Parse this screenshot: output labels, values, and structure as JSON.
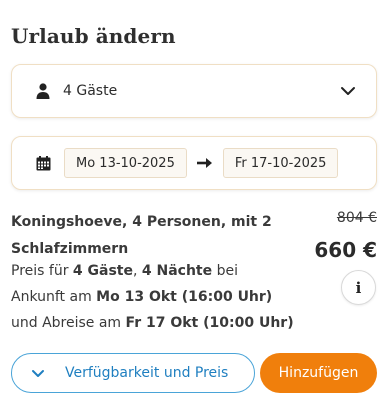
{
  "header": {
    "title": "Urlaub ändern"
  },
  "guests": {
    "label": "4 Gäste",
    "icon": "person-icon",
    "dropdown_icon": "chevron-down-icon"
  },
  "dates": {
    "icon": "calendar-icon",
    "start": "Mo 13-10-2025",
    "arrow_icon": "arrow-right-icon",
    "end": "Fr 17-10-2025"
  },
  "listing": {
    "name": "Koningshoeve, 4 Personen, mit 2 Schlafzimmern",
    "price_prefix": "Preis für ",
    "guests": "4 Gäste",
    "separator": ", ",
    "nights": "4 Nächte",
    "price_suffix": " bei",
    "arrival_prefix": "Ankunft am ",
    "arrival": "Mo 13 Okt (16:00 Uhr)",
    "departure_prefix": "und Abreise am ",
    "departure": "Fr 17 Okt (10:00 Uhr)"
  },
  "price": {
    "old": "804 €",
    "new": "660 €",
    "info_label": "i"
  },
  "actions": {
    "availability_label": "Verfügbarkeit und Preis",
    "add_label": "Hinzufügen"
  },
  "colors": {
    "accent": "#f07f0c",
    "link": "#1f7fc0",
    "border": "#f0dfc4"
  }
}
